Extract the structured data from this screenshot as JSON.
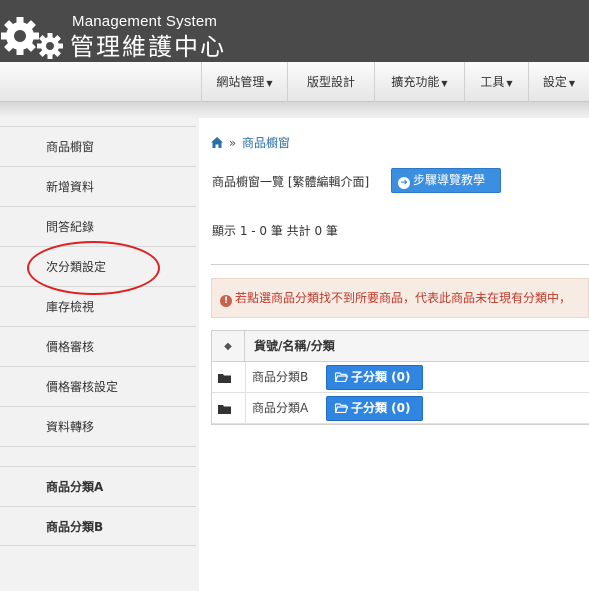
{
  "header": {
    "title_en": "Management System",
    "title_zh": "管理維護中心"
  },
  "nav": {
    "items": [
      {
        "label": "網站管理",
        "dropdown": true
      },
      {
        "label": "版型設計",
        "dropdown": false
      },
      {
        "label": "擴充功能",
        "dropdown": true
      },
      {
        "label": "工具",
        "dropdown": true
      },
      {
        "label": "設定",
        "dropdown": true
      }
    ]
  },
  "sidebar": {
    "items": [
      {
        "label": "商品櫥窗"
      },
      {
        "label": "新增資料"
      },
      {
        "label": "問答紀錄"
      },
      {
        "label": "次分類設定",
        "highlighted": true
      },
      {
        "label": "庫存檢視"
      },
      {
        "label": "價格審核"
      },
      {
        "label": "價格審核設定"
      },
      {
        "label": "資料轉移"
      },
      {
        "label": "商品分類A"
      },
      {
        "label": "商品分類B"
      }
    ]
  },
  "main": {
    "breadcrumb_sep": "»",
    "breadcrumb_current": "商品櫥窗",
    "page_title": "商品櫥窗一覽 [繁體編輯介面]",
    "guide_button": "步驟導覽教學",
    "count_text": "顯示 1 - 0 筆 共計 0 筆",
    "alert_text": "若點選商品分類找不到所要商品，代表此商品未在現有分類中，",
    "table": {
      "sort_symbol": "◆",
      "header": "貨號/名稱/分類",
      "rows": [
        {
          "name": "商品分類B",
          "button": "子分類 (0)"
        },
        {
          "name": "商品分類A",
          "button": "子分類 (0)"
        }
      ]
    }
  },
  "colors": {
    "header_bg": "#4a4a4a",
    "accent": "#3b8fe0",
    "alert_text": "#c0392b",
    "highlight": "#e02020"
  }
}
